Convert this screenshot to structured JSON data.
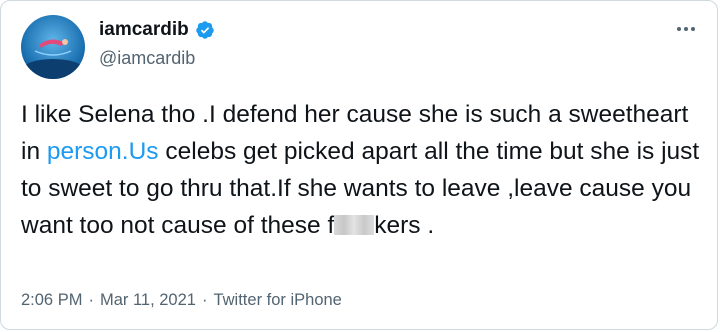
{
  "user": {
    "display_name": "iamcardib",
    "handle": "@iamcardib",
    "verified": true,
    "verified_color": "#1d9bf0"
  },
  "more_icon": "more-horizontal-icon",
  "tweet": {
    "part1": "I like Selena tho .I defend her cause she is such a sweetheart in ",
    "link_text": "person.Us",
    "part2": " celebs get picked apart all the time but she is just to sweet to go thru that.If she wants to leave ,leave cause you want too not cause of these f",
    "part3": "kers .",
    "link_color": "#1d9bf0"
  },
  "meta": {
    "time": "2:06 PM",
    "separator1": "·",
    "date": "Mar 11, 2021",
    "separator2": "·",
    "source": "Twitter for iPhone"
  }
}
